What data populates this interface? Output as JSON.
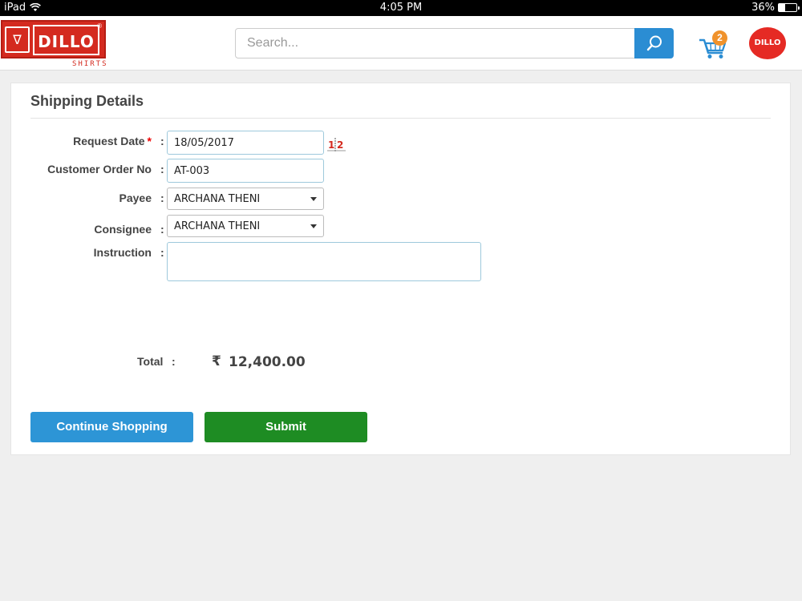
{
  "status_bar": {
    "device": "iPad",
    "time": "4:05 PM",
    "battery": "36%",
    "battery_level": 0.36
  },
  "header": {
    "logo": {
      "brand": "DILLO",
      "sub": "SHIRTS",
      "registered_mark": "®"
    },
    "search": {
      "placeholder": "Search...",
      "value": ""
    },
    "cart_count": "2",
    "avatar_text": "DILLO"
  },
  "shipping": {
    "title": "Shipping Details",
    "fields": {
      "request_date": {
        "label": "Request Date",
        "required_mark": "*",
        "value": "18/05/2017"
      },
      "customer_order_no": {
        "label": "Customer Order No",
        "value": "AT-003"
      },
      "payee": {
        "label": "Payee",
        "value": "ARCHANA THENI"
      },
      "consignee": {
        "label": "Consignee",
        "value": "ARCHANA THENI"
      },
      "instruction": {
        "label": "Instruction",
        "value": ""
      }
    },
    "colon": ":",
    "total": {
      "label": "Total",
      "currency": "₹",
      "value": "12,400.00"
    }
  },
  "buttons": {
    "continue_shopping": "Continue Shopping",
    "submit": "Submit"
  },
  "colors": {
    "brand_red": "#d42a1f",
    "search_blue": "#2b8dd3",
    "submit_green": "#1e8c23",
    "badge_orange": "#f0922b"
  }
}
